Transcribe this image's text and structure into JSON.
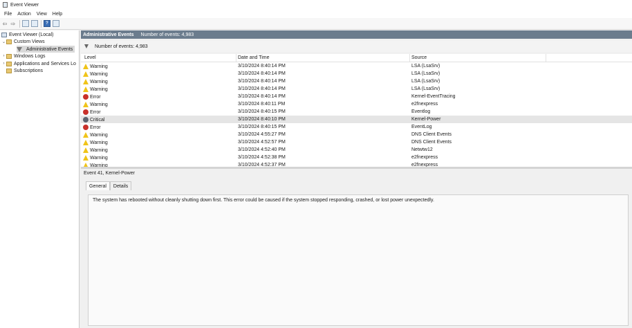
{
  "window": {
    "title": "Event Viewer"
  },
  "menu": [
    "File",
    "Action",
    "View",
    "Help"
  ],
  "toolbar": {
    "buttons": [
      "back-arrow-icon",
      "forward-arrow-icon",
      "up-folder-icon",
      "properties-icon",
      "help-icon",
      "show-hide-pane-icon"
    ]
  },
  "tree": {
    "root": "Event Viewer (Local)",
    "custom_views": "Custom Views",
    "admin_events": "Administrative Events",
    "windows_logs": "Windows Logs",
    "apps_services": "Applications and Services Lo",
    "subscriptions": "Subscriptions"
  },
  "header": {
    "title": "Administrative Events",
    "count": "Number of events: 4,983"
  },
  "filter": {
    "text": "Number of events: 4,983"
  },
  "columns": {
    "level": "Level",
    "date": "Date and Time",
    "source": "Source"
  },
  "events": [
    {
      "level": "Warning",
      "icon": "warning",
      "date": "3/10/2024 8:40:14 PM",
      "source": "LSA (LsaSrv)"
    },
    {
      "level": "Warning",
      "icon": "warning",
      "date": "3/10/2024 8:40:14 PM",
      "source": "LSA (LsaSrv)"
    },
    {
      "level": "Warning",
      "icon": "warning",
      "date": "3/10/2024 8:40:14 PM",
      "source": "LSA (LsaSrv)"
    },
    {
      "level": "Warning",
      "icon": "warning",
      "date": "3/10/2024 8:40:14 PM",
      "source": "LSA (LsaSrv)"
    },
    {
      "level": "Error",
      "icon": "error",
      "date": "3/10/2024 8:40:14 PM",
      "source": "Kernel-EventTracing"
    },
    {
      "level": "Warning",
      "icon": "warning",
      "date": "3/10/2024 8:40:11 PM",
      "source": "e2fnexpress"
    },
    {
      "level": "Error",
      "icon": "error",
      "date": "3/10/2024 8:40:15 PM",
      "source": "Eventlog"
    },
    {
      "level": "Critical",
      "icon": "critical",
      "date": "3/10/2024 8:40:10 PM",
      "source": "Kernel-Power"
    },
    {
      "level": "Error",
      "icon": "error",
      "date": "3/10/2024 8:40:15 PM",
      "source": "EventLog"
    },
    {
      "level": "Warning",
      "icon": "warning",
      "date": "3/10/2024 4:55:27 PM",
      "source": "DNS Client Events"
    },
    {
      "level": "Warning",
      "icon": "warning",
      "date": "3/10/2024 4:52:57 PM",
      "source": "DNS Client Events"
    },
    {
      "level": "Warning",
      "icon": "warning",
      "date": "3/10/2024 4:52:40 PM",
      "source": "Netwtw12"
    },
    {
      "level": "Warning",
      "icon": "warning",
      "date": "3/10/2024 4:52:38 PM",
      "source": "e2fnexpress"
    },
    {
      "level": "Warning",
      "icon": "warning",
      "date": "3/10/2024 4:52:37 PM",
      "source": "e2fnexpress"
    }
  ],
  "selected_event_index": 7,
  "detail": {
    "title": "Event 41, Kernel-Power",
    "tabs": [
      "General",
      "Details"
    ],
    "message": "The system has rebooted without cleanly shutting down first. This error could be caused if the system stopped responding, crashed, or lost power unexpectedly."
  },
  "colors": {
    "header_bg": "#6b7c8d",
    "warning": "#f0c419",
    "error": "#c9312b",
    "critical": "#5d6470",
    "selection": "#e5e5e5"
  }
}
